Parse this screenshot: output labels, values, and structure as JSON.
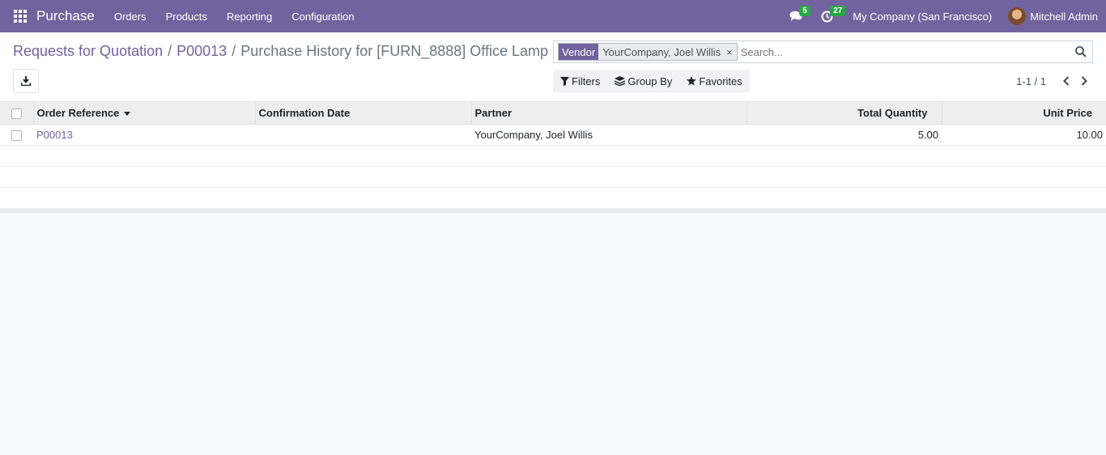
{
  "navbar": {
    "brand": "Purchase",
    "menu": [
      {
        "label": "Orders"
      },
      {
        "label": "Products"
      },
      {
        "label": "Reporting"
      },
      {
        "label": "Configuration"
      }
    ],
    "messages_count": "5",
    "activities_count": "27",
    "company": "My Company (San Francisco)",
    "user": "Mitchell Admin"
  },
  "breadcrumb": {
    "items": [
      "Requests for Quotation",
      "P00013"
    ],
    "separator": "/",
    "current": "Purchase History for [FURN_8888] Office Lamp"
  },
  "search": {
    "facet_label": "Vendor",
    "facet_value": "YourCompany, Joel Willis",
    "facet_remove": "×",
    "placeholder": "Search..."
  },
  "filters": {
    "filters_label": "Filters",
    "group_by_label": "Group By",
    "favorites_label": "Favorites"
  },
  "pager": {
    "value": "1-1 / 1"
  },
  "table": {
    "columns": [
      "Order Reference",
      "Confirmation Date",
      "Partner",
      "Total Quantity",
      "Unit Price"
    ],
    "rows": [
      {
        "order_reference": "P00013",
        "confirmation_date": "",
        "partner": "YourCompany, Joel Willis",
        "total_quantity": "5.00",
        "unit_price": "10.00"
      }
    ]
  },
  "colors": {
    "brand": "#71639e",
    "badge": "#28a745"
  }
}
